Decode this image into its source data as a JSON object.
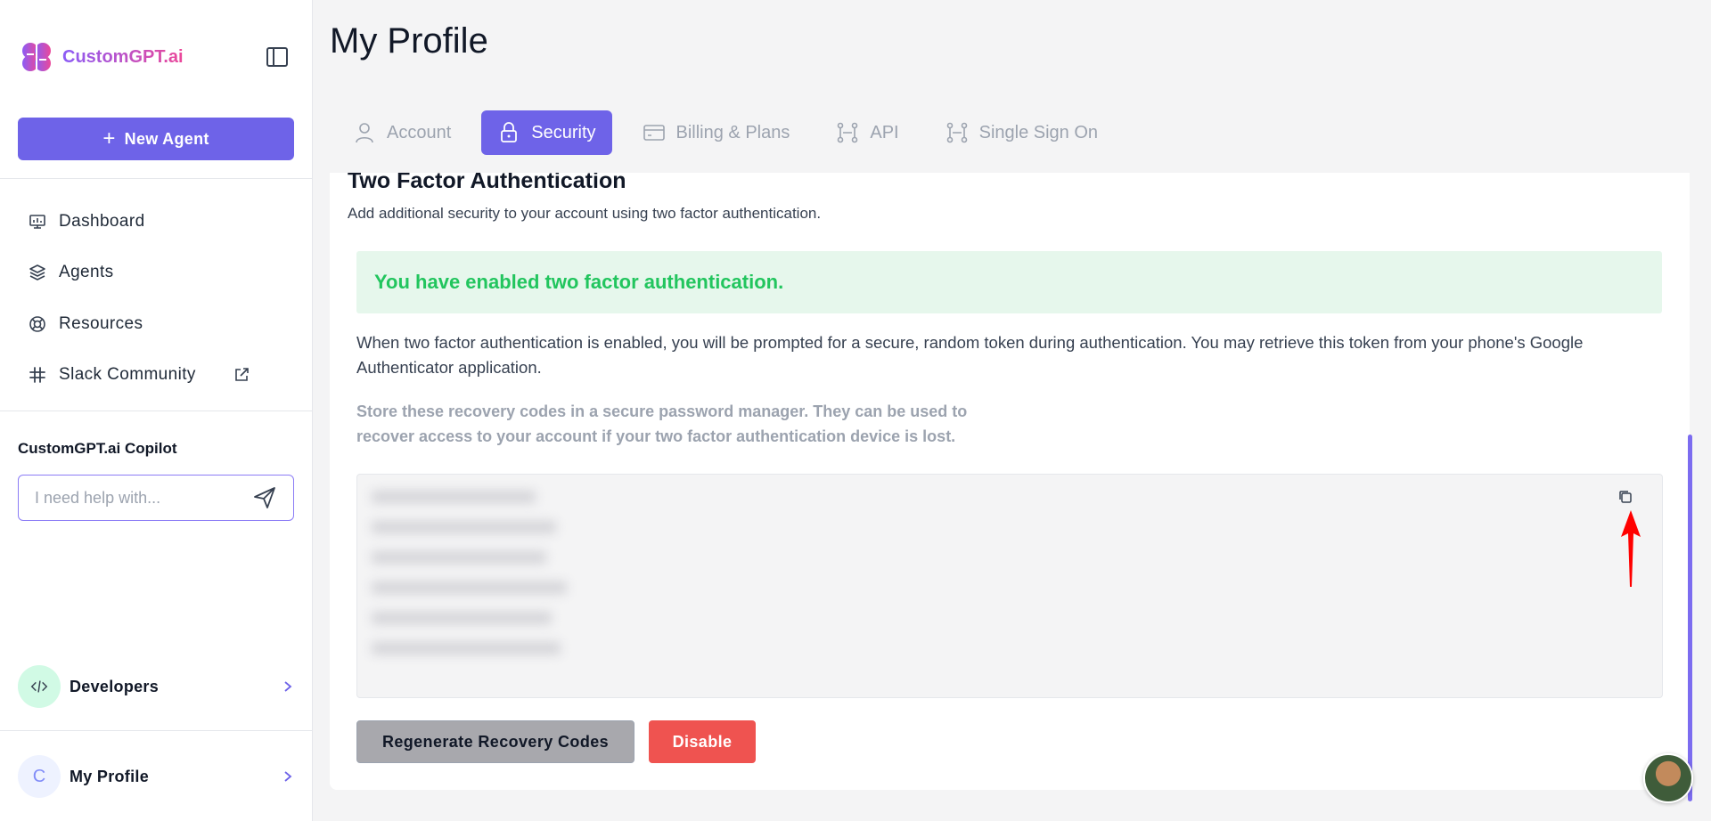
{
  "app": {
    "brand": "CustomGPT.ai"
  },
  "sidebar": {
    "new_agent_label": "New Agent",
    "nav": [
      {
        "label": "Dashboard",
        "icon": "dashboard-icon"
      },
      {
        "label": "Agents",
        "icon": "layers-icon"
      },
      {
        "label": "Resources",
        "icon": "lifebuoy-icon"
      },
      {
        "label": "Slack Community",
        "icon": "slack-icon",
        "external": true
      }
    ],
    "copilot": {
      "title": "CustomGPT.ai Copilot",
      "placeholder": "I need help with..."
    },
    "developers_label": "Developers",
    "profile": {
      "initial": "C",
      "label": "My Profile"
    }
  },
  "main": {
    "title": "My Profile",
    "tabs": [
      {
        "label": "Account",
        "icon": "user-icon",
        "active": false
      },
      {
        "label": "Security",
        "icon": "lock-icon",
        "active": true
      },
      {
        "label": "Billing & Plans",
        "icon": "card-icon",
        "active": false
      },
      {
        "label": "API",
        "icon": "api-icon",
        "active": false
      },
      {
        "label": "Single Sign On",
        "icon": "sso-icon",
        "active": false
      }
    ],
    "section": {
      "title": "Two Factor Authentication",
      "subtitle": "Add additional security to your account using two factor authentication.",
      "alert": "You have enabled two factor authentication.",
      "description": "When two factor authentication is enabled, you will be prompted for a secure, random token during authentication. You may retrieve this token from your phone's Google Authenticator application.",
      "recovery_note": "Store these recovery codes in a secure password manager. They can be used to recover access to your account if your two factor authentication device is lost.",
      "regenerate_label": "Regenerate Recovery Codes",
      "disable_label": "Disable"
    }
  },
  "colors": {
    "accent": "#6e63e8",
    "success": "#22c55e",
    "danger": "#ef5350"
  }
}
